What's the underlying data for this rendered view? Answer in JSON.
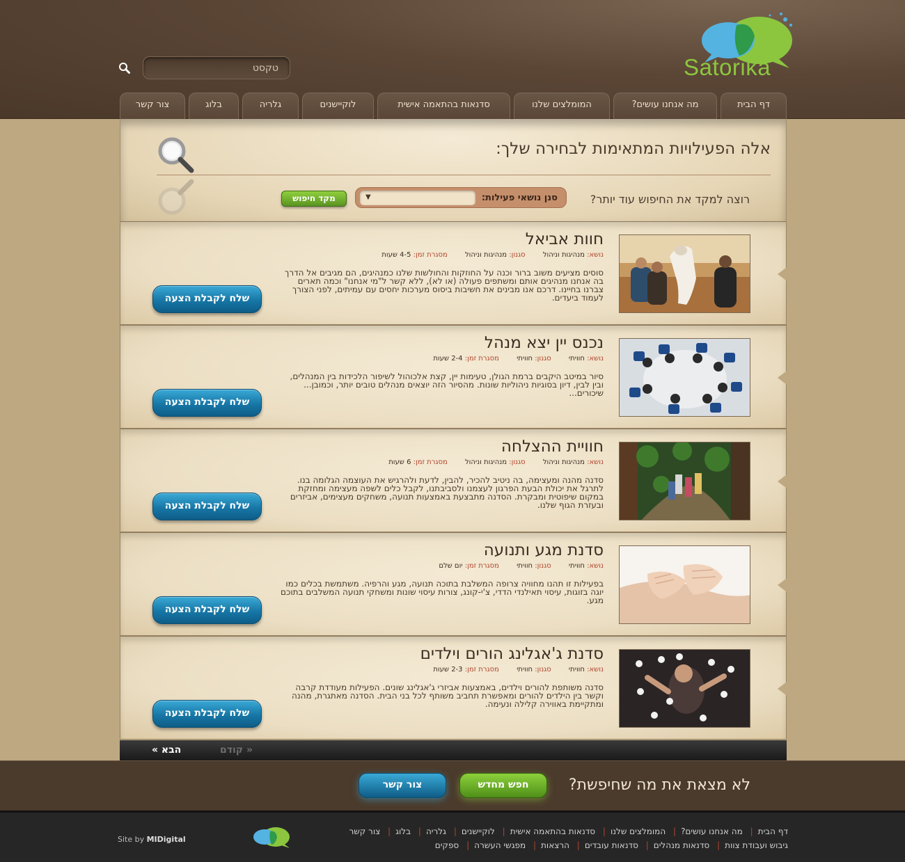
{
  "header": {
    "logo_text": "Satorika",
    "search_placeholder": "טקסט",
    "nav": [
      {
        "label": "דף הבית"
      },
      {
        "label": "מה אנחנו עושים?"
      },
      {
        "label": "המומלצים שלנו"
      },
      {
        "label": "סדנאות בהתאמה אישית"
      },
      {
        "label": "לוקיישנים"
      },
      {
        "label": "גלריה"
      },
      {
        "label": "בלוג"
      },
      {
        "label": "צור קשר"
      }
    ]
  },
  "search_panel": {
    "title": "אלה הפעילויות המתאימות לבחירה שלך:",
    "refine_label": "רוצה למקד את החיפוש עוד יותר?",
    "filter_label": "סנן נושאי פעילות:",
    "focus_button": "מקד חיפוש"
  },
  "labels": {
    "topic": "נושא:",
    "style": "סגנון:",
    "duration": "מסגרת זמן:",
    "cta": "שלח לקבלת הצעה"
  },
  "activities": [
    {
      "title": "חוות אביאל",
      "topic": "מנהיגות וניהול",
      "style": "מנהיגות וניהול",
      "duration": "4-5 שעות",
      "description": "סוסים מציעים משוב ברור וכנה על החוזקות והחולשות שלנו כמנהיגים, הם מגיבים אל הדרך בה אנחנו מנהיגים אותם ומשתפים פעולה (או לא), ללא קשר ל\"מי אנחנו\" וכמה תארים צברנו בחיינו. דרכם אנו מבינים את חשיבות ביסוס מערכות יחסים עם עמיתים, לפני הצורך לעמוד ביעדים.",
      "image": "horse-photo"
    },
    {
      "title": "נכנס יין יצא מנהל",
      "topic": "חוויתי",
      "style": "חוויתי",
      "duration": "2-4 שעות",
      "description": "סיור במיטב היקבים ברמת הגולן, טעימות יין, קצת אלכוהול לשיפור הלכידות בין המנהלים, ובין לבין, דיון בסוגיות ניהוליות שונות. מהסיור הזה יוצאים מנהלים טובים יותר, וכמובן... שיכורים...",
      "image": "meeting-photo"
    },
    {
      "title": "חוויית ההצלחה",
      "topic": "מנהיגות וניהול",
      "style": "מנהיגות וניהול",
      "duration": "6 שעות",
      "description": "סדנה מהנה ומעצימה, בה ניטיב להכיר, להבין, לדעת ולהרגיש את העוצמה הגלומה בנו. לתרגל את יכולת הבעת הפרגון לעצמנו ולסביבתנו, לקבל כלים לשפה מעצימה ומחזקת במקום שיפוטית ומבקרת. הסדנה מתבצעת באמצעות תנועה, משחקים מעצימים, אביזרים ובעזרת הגוף שלנו.",
      "image": "hiking-photo"
    },
    {
      "title": "סדנת מגע ותנועה",
      "topic": "חוויתי",
      "style": "חוויתי",
      "duration": "יום שלם",
      "description": "בפעילות זו תהנו מחוויה צרופה המשלבת בתוכה תנועה, מגע והרפיה. משתמשת בכלים כמו יוגה בזוגות, עיסוי תאילנדי הדדי, צ'י-קונג, צורות עיסוי שונות ומשחקי תנועה המשלבים בתוכם מגע.",
      "image": "massage-photo"
    },
    {
      "title": "סדנת ג'אגלינג הורים וילדים",
      "topic": "חוויתי",
      "style": "חוויתי",
      "duration": "2-3 שעות",
      "description": "סדנה משותפת להורים וילדים, באמצעות אביזרי ג'אגלינג שונים. הפעילות מעודדת קרבה וקשר בין הילדים להורים ומאפשרת תחביב משותף לכל בני הבית. הסדנה מאתגרת, מהנה ומתקיימת באווירה קלילה ונעימה.",
      "image": "juggling-photo"
    }
  ],
  "pager": {
    "next": "הבא »",
    "prev": "« קודם"
  },
  "strip": {
    "question": "לא מצאת את מה שחיפשת?",
    "search_again": "חפש מחדש",
    "contact": "צור קשר"
  },
  "footer": {
    "row1": [
      "דף הבית",
      "מה אנחנו עושים?",
      "המומלצים שלנו",
      "סדנאות בהתאמה אישית",
      "לוקיישנים",
      "גלריה",
      "בלוג",
      "צור קשר"
    ],
    "row2": [
      "גיבוש ועבודת צוות",
      "סדנאות מנהלים",
      "סדנאות עובדים",
      "הרצאות",
      "מפגשי העשרה",
      "ספקים"
    ],
    "credit_prefix": "Site by",
    "credit_name": "MIDigital"
  }
}
